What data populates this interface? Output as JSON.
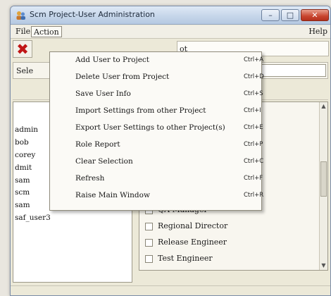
{
  "window": {
    "title": "Scm Project-User Administration",
    "icon": "app-people-icon",
    "controls": {
      "minimize": "minimize-icon",
      "maximize": "maximize-icon",
      "close": "close-icon"
    }
  },
  "menubar": {
    "file": "File",
    "action": "Action",
    "help": "Help"
  },
  "toolbar": {
    "delete_icon": "red-x-icon",
    "right_text": "ot"
  },
  "selector": {
    "label": "Sele"
  },
  "users": [
    "admin",
    "bob",
    "corey",
    "dmit",
    "sam",
    "scm",
    "sam",
    "saf_user3"
  ],
  "roles": [
    {
      "label": "QA Manager",
      "checked": false
    },
    {
      "label": "Regional Director",
      "checked": false
    },
    {
      "label": "Release Engineer",
      "checked": false
    },
    {
      "label": "Test Engineer",
      "checked": false
    }
  ],
  "action_menu": {
    "items": [
      {
        "label": "Add User to Project",
        "shortcut": "Ctrl+A"
      },
      {
        "label": "Delete User from Project",
        "shortcut": "Ctrl+D"
      },
      {
        "label": "Save User Info",
        "shortcut": "Ctrl+S"
      },
      {
        "label": "Import Settings from other Project",
        "shortcut": "Ctrl+I"
      },
      {
        "label": "Export User Settings to other Project(s)",
        "shortcut": "Ctrl+E"
      },
      {
        "label": "Role Report",
        "shortcut": "Ctrl+P"
      },
      {
        "label": "Clear Selection",
        "shortcut": "Ctrl+C"
      },
      {
        "label": "Refresh",
        "shortcut": "Ctrl+F"
      },
      {
        "label": "Raise Main Window",
        "shortcut": "Ctrl+R"
      }
    ]
  },
  "colors": {
    "delete_red": "#c01616",
    "titlebar": "#c6d6ea",
    "close_button": "#c8452e"
  }
}
